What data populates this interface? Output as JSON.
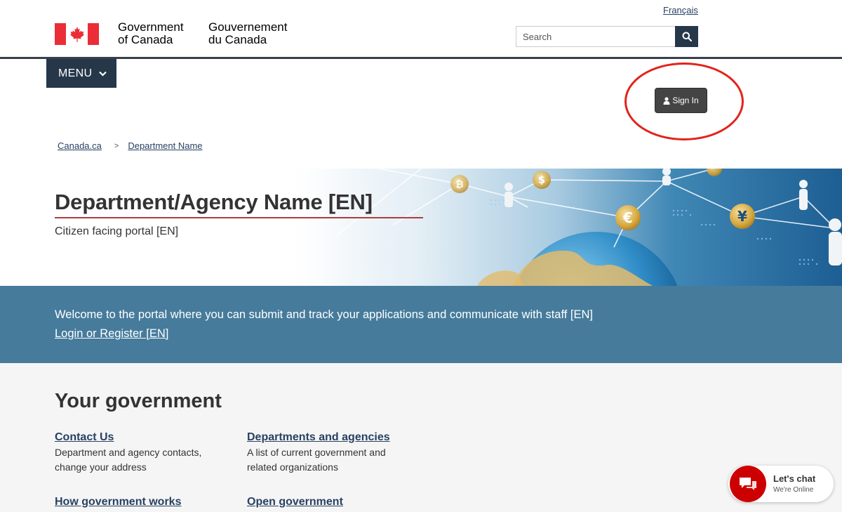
{
  "header": {
    "language_link": "Français",
    "wordmark_en_line1": "Government",
    "wordmark_en_line2": "of Canada",
    "wordmark_fr_line1": "Gouvernement",
    "wordmark_fr_line2": "du Canada",
    "search_placeholder": "Search",
    "menu_label": "MENU",
    "sign_in_label": "Sign In"
  },
  "breadcrumb": {
    "items": [
      "Canada.ca",
      "Department Name"
    ],
    "separator": ">"
  },
  "hero": {
    "title": "Department/Agency Name [EN]",
    "subtitle": "Citizen facing portal [EN]"
  },
  "welcome": {
    "text": "Welcome to the portal where you can submit and track your applications and communicate with staff [EN]",
    "link": "Login or Register [EN]"
  },
  "government": {
    "title": "Your government",
    "items": [
      {
        "label": "Contact Us",
        "description": "Department and agency contacts, change your address"
      },
      {
        "label": "Departments and agencies",
        "description": "A list of current government and related organizations"
      },
      {
        "label": "How government works",
        "description": ""
      },
      {
        "label": "Open government",
        "description": ""
      }
    ]
  },
  "chat": {
    "title": "Let's chat",
    "status": "We're Online"
  },
  "colors": {
    "fip_red": "#eb2d37",
    "navy": "#26374a",
    "band": "#467b9b",
    "annotation": "#e2231a"
  }
}
